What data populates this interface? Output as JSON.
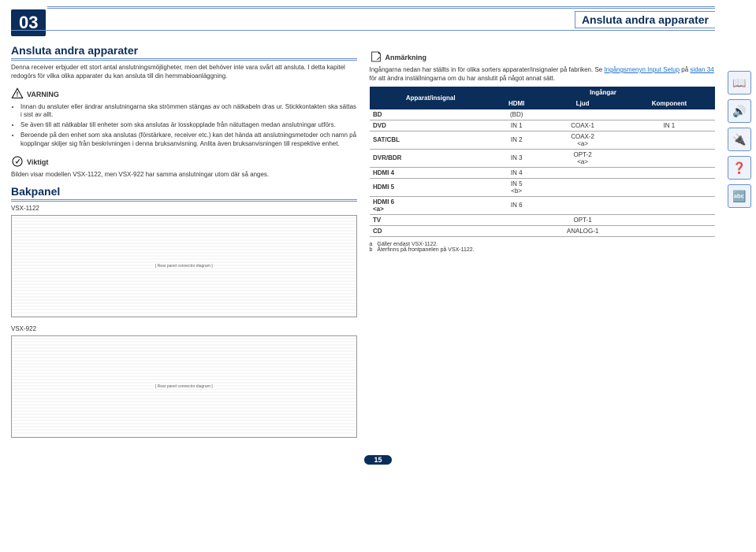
{
  "chapter_number": "03",
  "header_title": "Ansluta andra apparater",
  "left": {
    "h1": "Ansluta andra apparater",
    "intro": "Denna receiver erbjuder ett stort antal anslutningsmöjligheter, men det behöver inte vara svårt att ansluta. I detta kapitel redogörs för vilka olika apparater du kan ansluta till din hemmabioanläggning.",
    "warning_label": "VARNING",
    "warning_items": [
      "Innan du ansluter eller ändrar anslutningarna ska strömmen stängas av och nätkabeln dras ur. Stickkontakten ska sättas i sist av allt.",
      "Se även till att nätkablar till enheter som ska anslutas är losskopplade från nätuttagen medan anslutningar utförs.",
      "Beroende på den enhet som ska anslutas (förstärkare, receiver etc.) kan det hända att anslutningsmetoder och namn på kopplingar skiljer sig från beskrivningen i denna bruksanvisning. Anlita även bruksanvisningen till respektive enhet."
    ],
    "important_label": "Viktigt",
    "important_text": "Bilden visar modellen VSX-1122, men VSX-922 har samma anslutningar utom där så anges.",
    "bakpanel_title": "Bakpanel",
    "model1": "VSX-1122",
    "model2": "VSX-922",
    "diagram_placeholder": "[ Rear panel connector diagram ]"
  },
  "right": {
    "note_label": "Anmärkning",
    "note_text_1": "Ingångarna nedan har ställts in för olika sorters apparater/insignaler på fabriken. Se ",
    "note_link_1": "Ingångsmenyn Input Setup",
    "note_text_2": " på ",
    "note_link_2": "sidan 34",
    "note_text_3": " för att ändra inställningarna om du har anslutit på något annat sätt.",
    "table": {
      "head_apparat": "Apparat/insignal",
      "head_ingangar": "Ingångar",
      "head_hdmi": "HDMI",
      "head_ljud": "Ljud",
      "head_komponent": "Komponent",
      "rows": [
        {
          "name": "BD",
          "hdmi": "(BD)",
          "ljud": "",
          "komp": ""
        },
        {
          "name": "DVD",
          "hdmi": "IN 1",
          "ljud": "COAX-1",
          "komp": "IN 1"
        },
        {
          "name": "SAT/CBL",
          "hdmi": "IN 2",
          "ljud": "COAX-2\n<a>",
          "komp": ""
        },
        {
          "name": "DVR/BDR",
          "hdmi": "IN 3",
          "ljud": "OPT-2\n<a>",
          "komp": ""
        },
        {
          "name": "HDMI 4",
          "hdmi": "IN 4",
          "ljud": "",
          "komp": ""
        },
        {
          "name": "HDMI 5",
          "hdmi": "IN 5\n<b>",
          "ljud": "",
          "komp": ""
        },
        {
          "name": "HDMI 6\n<a>",
          "hdmi": "IN 6",
          "ljud": "",
          "komp": ""
        },
        {
          "name": "TV",
          "hdmi": "",
          "ljud": "OPT-1",
          "komp": ""
        },
        {
          "name": "CD",
          "hdmi": "",
          "ljud": "ANALOG-1",
          "komp": ""
        }
      ]
    },
    "footnote_a_label": "a",
    "footnote_a": "Gäller endast VSX-1122.",
    "footnote_b_label": "b",
    "footnote_b": "Återfinns på frontpanelen på VSX-1122."
  },
  "page_number": "15",
  "side_labels": [
    "📖",
    "🔊",
    "🔌",
    "❓",
    "🔤"
  ]
}
